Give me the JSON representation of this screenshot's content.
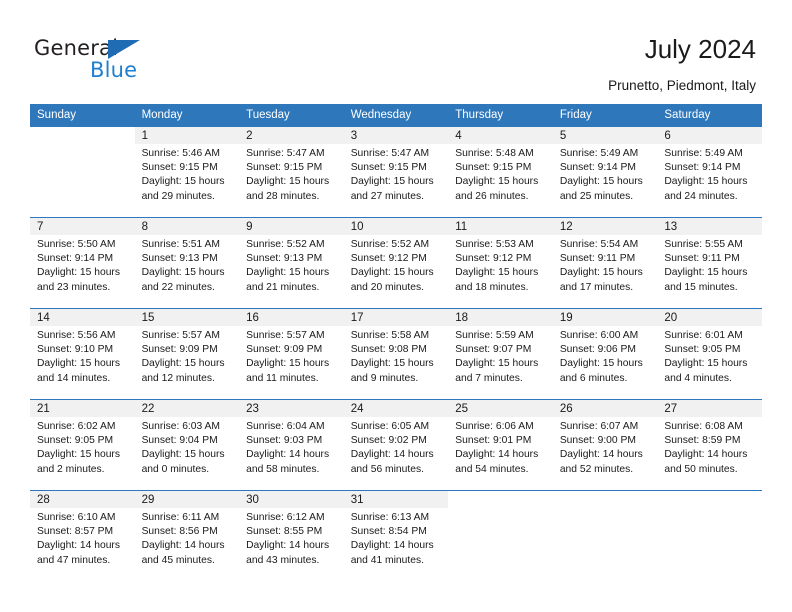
{
  "brand": {
    "name_top": "General",
    "name_bottom": "Blue",
    "triangle_color": "#1f6cb4",
    "blue_color": "#1f7fd0"
  },
  "header": {
    "title": "July 2024",
    "location": "Prunetto, Piedmont, Italy"
  },
  "theme": {
    "header_blue": "#2e77bb",
    "daynum_band": "#f1f1f1",
    "text": "#1a1a1a"
  },
  "weekdays": [
    "Sunday",
    "Monday",
    "Tuesday",
    "Wednesday",
    "Thursday",
    "Friday",
    "Saturday"
  ],
  "labels": {
    "sunrise_prefix": "Sunrise:",
    "sunset_prefix": "Sunset:",
    "daylight_prefix": "Daylight:"
  },
  "weeks": [
    [
      {
        "day": "",
        "l1": "",
        "l2": "",
        "l3": "",
        "l4": ""
      },
      {
        "day": "1",
        "l1": "Sunrise: 5:46 AM",
        "l2": "Sunset: 9:15 PM",
        "l3": "Daylight: 15 hours",
        "l4": "and 29 minutes."
      },
      {
        "day": "2",
        "l1": "Sunrise: 5:47 AM",
        "l2": "Sunset: 9:15 PM",
        "l3": "Daylight: 15 hours",
        "l4": "and 28 minutes."
      },
      {
        "day": "3",
        "l1": "Sunrise: 5:47 AM",
        "l2": "Sunset: 9:15 PM",
        "l3": "Daylight: 15 hours",
        "l4": "and 27 minutes."
      },
      {
        "day": "4",
        "l1": "Sunrise: 5:48 AM",
        "l2": "Sunset: 9:15 PM",
        "l3": "Daylight: 15 hours",
        "l4": "and 26 minutes."
      },
      {
        "day": "5",
        "l1": "Sunrise: 5:49 AM",
        "l2": "Sunset: 9:14 PM",
        "l3": "Daylight: 15 hours",
        "l4": "and 25 minutes."
      },
      {
        "day": "6",
        "l1": "Sunrise: 5:49 AM",
        "l2": "Sunset: 9:14 PM",
        "l3": "Daylight: 15 hours",
        "l4": "and 24 minutes."
      }
    ],
    [
      {
        "day": "7",
        "l1": "Sunrise: 5:50 AM",
        "l2": "Sunset: 9:14 PM",
        "l3": "Daylight: 15 hours",
        "l4": "and 23 minutes."
      },
      {
        "day": "8",
        "l1": "Sunrise: 5:51 AM",
        "l2": "Sunset: 9:13 PM",
        "l3": "Daylight: 15 hours",
        "l4": "and 22 minutes."
      },
      {
        "day": "9",
        "l1": "Sunrise: 5:52 AM",
        "l2": "Sunset: 9:13 PM",
        "l3": "Daylight: 15 hours",
        "l4": "and 21 minutes."
      },
      {
        "day": "10",
        "l1": "Sunrise: 5:52 AM",
        "l2": "Sunset: 9:12 PM",
        "l3": "Daylight: 15 hours",
        "l4": "and 20 minutes."
      },
      {
        "day": "11",
        "l1": "Sunrise: 5:53 AM",
        "l2": "Sunset: 9:12 PM",
        "l3": "Daylight: 15 hours",
        "l4": "and 18 minutes."
      },
      {
        "day": "12",
        "l1": "Sunrise: 5:54 AM",
        "l2": "Sunset: 9:11 PM",
        "l3": "Daylight: 15 hours",
        "l4": "and 17 minutes."
      },
      {
        "day": "13",
        "l1": "Sunrise: 5:55 AM",
        "l2": "Sunset: 9:11 PM",
        "l3": "Daylight: 15 hours",
        "l4": "and 15 minutes."
      }
    ],
    [
      {
        "day": "14",
        "l1": "Sunrise: 5:56 AM",
        "l2": "Sunset: 9:10 PM",
        "l3": "Daylight: 15 hours",
        "l4": "and 14 minutes."
      },
      {
        "day": "15",
        "l1": "Sunrise: 5:57 AM",
        "l2": "Sunset: 9:09 PM",
        "l3": "Daylight: 15 hours",
        "l4": "and 12 minutes."
      },
      {
        "day": "16",
        "l1": "Sunrise: 5:57 AM",
        "l2": "Sunset: 9:09 PM",
        "l3": "Daylight: 15 hours",
        "l4": "and 11 minutes."
      },
      {
        "day": "17",
        "l1": "Sunrise: 5:58 AM",
        "l2": "Sunset: 9:08 PM",
        "l3": "Daylight: 15 hours",
        "l4": "and 9 minutes."
      },
      {
        "day": "18",
        "l1": "Sunrise: 5:59 AM",
        "l2": "Sunset: 9:07 PM",
        "l3": "Daylight: 15 hours",
        "l4": "and 7 minutes."
      },
      {
        "day": "19",
        "l1": "Sunrise: 6:00 AM",
        "l2": "Sunset: 9:06 PM",
        "l3": "Daylight: 15 hours",
        "l4": "and 6 minutes."
      },
      {
        "day": "20",
        "l1": "Sunrise: 6:01 AM",
        "l2": "Sunset: 9:05 PM",
        "l3": "Daylight: 15 hours",
        "l4": "and 4 minutes."
      }
    ],
    [
      {
        "day": "21",
        "l1": "Sunrise: 6:02 AM",
        "l2": "Sunset: 9:05 PM",
        "l3": "Daylight: 15 hours",
        "l4": "and 2 minutes."
      },
      {
        "day": "22",
        "l1": "Sunrise: 6:03 AM",
        "l2": "Sunset: 9:04 PM",
        "l3": "Daylight: 15 hours",
        "l4": "and 0 minutes."
      },
      {
        "day": "23",
        "l1": "Sunrise: 6:04 AM",
        "l2": "Sunset: 9:03 PM",
        "l3": "Daylight: 14 hours",
        "l4": "and 58 minutes."
      },
      {
        "day": "24",
        "l1": "Sunrise: 6:05 AM",
        "l2": "Sunset: 9:02 PM",
        "l3": "Daylight: 14 hours",
        "l4": "and 56 minutes."
      },
      {
        "day": "25",
        "l1": "Sunrise: 6:06 AM",
        "l2": "Sunset: 9:01 PM",
        "l3": "Daylight: 14 hours",
        "l4": "and 54 minutes."
      },
      {
        "day": "26",
        "l1": "Sunrise: 6:07 AM",
        "l2": "Sunset: 9:00 PM",
        "l3": "Daylight: 14 hours",
        "l4": "and 52 minutes."
      },
      {
        "day": "27",
        "l1": "Sunrise: 6:08 AM",
        "l2": "Sunset: 8:59 PM",
        "l3": "Daylight: 14 hours",
        "l4": "and 50 minutes."
      }
    ],
    [
      {
        "day": "28",
        "l1": "Sunrise: 6:10 AM",
        "l2": "Sunset: 8:57 PM",
        "l3": "Daylight: 14 hours",
        "l4": "and 47 minutes."
      },
      {
        "day": "29",
        "l1": "Sunrise: 6:11 AM",
        "l2": "Sunset: 8:56 PM",
        "l3": "Daylight: 14 hours",
        "l4": "and 45 minutes."
      },
      {
        "day": "30",
        "l1": "Sunrise: 6:12 AM",
        "l2": "Sunset: 8:55 PM",
        "l3": "Daylight: 14 hours",
        "l4": "and 43 minutes."
      },
      {
        "day": "31",
        "l1": "Sunrise: 6:13 AM",
        "l2": "Sunset: 8:54 PM",
        "l3": "Daylight: 14 hours",
        "l4": "and 41 minutes."
      },
      {
        "day": "",
        "l1": "",
        "l2": "",
        "l3": "",
        "l4": ""
      },
      {
        "day": "",
        "l1": "",
        "l2": "",
        "l3": "",
        "l4": ""
      },
      {
        "day": "",
        "l1": "",
        "l2": "",
        "l3": "",
        "l4": ""
      }
    ]
  ]
}
